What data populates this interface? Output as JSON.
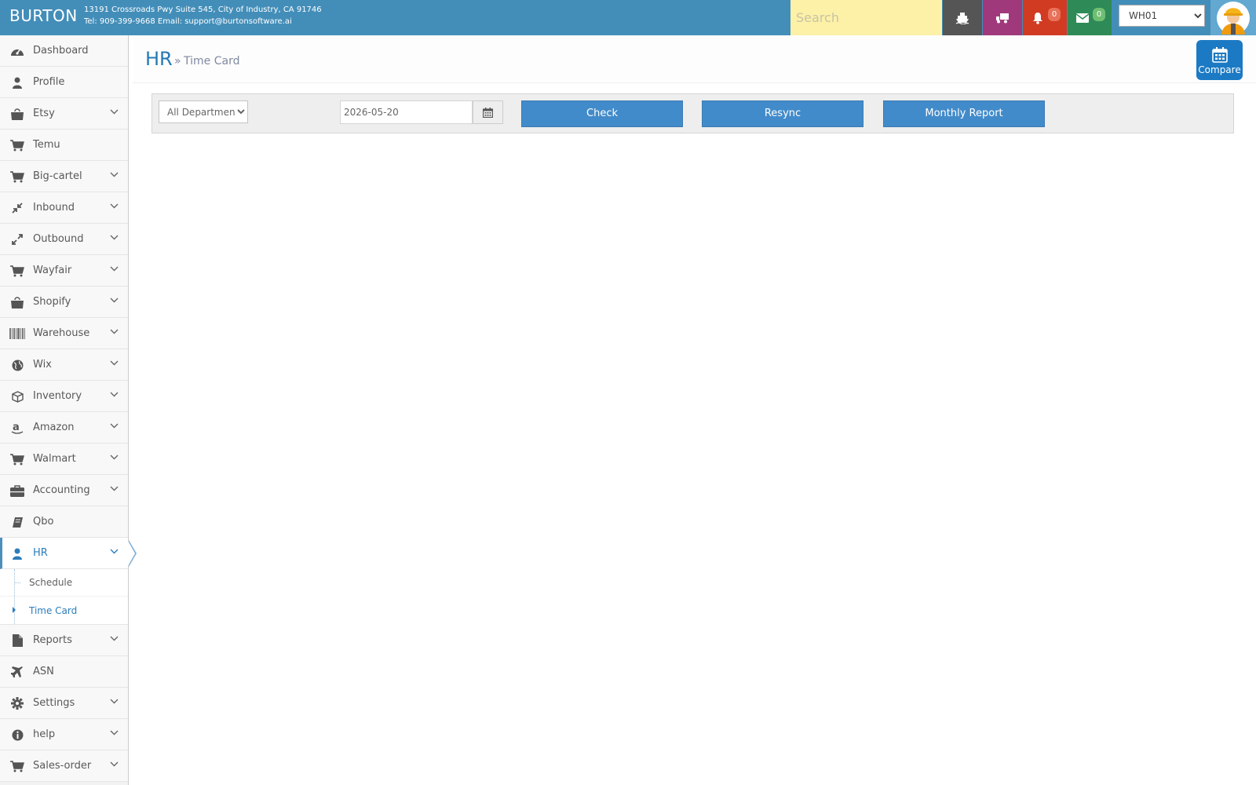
{
  "header": {
    "brand": "BURTON",
    "address_line1": "13191 Crossroads Pwy Suite 545, City of Industry, CA 91746",
    "address_line2": "Tel: 909-399-9668 Email: support@burtonsoftware.ai",
    "search_placeholder": "Search",
    "notifications_count": "0",
    "messages_count": "0",
    "warehouse_selected": "WH01",
    "colors": {
      "bar": "#438eb9",
      "search_bg": "#fdf1a8",
      "ship_btn": "#555555",
      "truck_btn": "#a0397c",
      "bell_btn": "#d03b22",
      "mail_btn": "#2e8b57"
    }
  },
  "sidebar": {
    "items": [
      {
        "label": "Dashboard",
        "icon": "dashboard-icon",
        "expandable": false
      },
      {
        "label": "Profile",
        "icon": "user-icon",
        "expandable": false
      },
      {
        "label": "Etsy",
        "icon": "shopping-bag-icon",
        "expandable": true
      },
      {
        "label": "Temu",
        "icon": "cart-icon",
        "expandable": false
      },
      {
        "label": "Big-cartel",
        "icon": "cart-icon",
        "expandable": true
      },
      {
        "label": "Inbound",
        "icon": "compress-arrows-icon",
        "expandable": true
      },
      {
        "label": "Outbound",
        "icon": "expand-arrows-icon",
        "expandable": true
      },
      {
        "label": "Wayfair",
        "icon": "cart-icon",
        "expandable": true
      },
      {
        "label": "Shopify",
        "icon": "shopping-bag-icon",
        "expandable": true
      },
      {
        "label": "Warehouse",
        "icon": "barcode-icon",
        "expandable": true
      },
      {
        "label": "Wix",
        "icon": "globe-icon",
        "expandable": true
      },
      {
        "label": "Inventory",
        "icon": "cube-icon",
        "expandable": true
      },
      {
        "label": "Amazon",
        "icon": "amazon-icon",
        "expandable": true
      },
      {
        "label": "Walmart",
        "icon": "cart-icon",
        "expandable": true
      },
      {
        "label": "Accounting",
        "icon": "briefcase-icon",
        "expandable": true
      },
      {
        "label": "Qbo",
        "icon": "book-icon",
        "expandable": false
      },
      {
        "label": "HR",
        "icon": "user-icon",
        "expandable": true,
        "active": true,
        "children": [
          {
            "label": "Schedule",
            "active": false
          },
          {
            "label": "Time Card",
            "active": true
          }
        ]
      },
      {
        "label": "Reports",
        "icon": "file-icon",
        "expandable": true
      },
      {
        "label": "ASN",
        "icon": "plane-icon",
        "expandable": false
      },
      {
        "label": "Settings",
        "icon": "gear-icon",
        "expandable": true
      },
      {
        "label": "help",
        "icon": "info-icon",
        "expandable": true
      },
      {
        "label": "Sales-order",
        "icon": "cart-icon",
        "expandable": true
      }
    ]
  },
  "page": {
    "title": "HR",
    "separator": "»",
    "subtitle": "Time Card",
    "compare_label": "Compare"
  },
  "toolbar": {
    "department_selected": "All Department",
    "date_value": "2026-05-20",
    "check_label": "Check",
    "resync_label": "Resync",
    "monthly_report_label": "Monthly Report",
    "button_color": "#428bca"
  }
}
